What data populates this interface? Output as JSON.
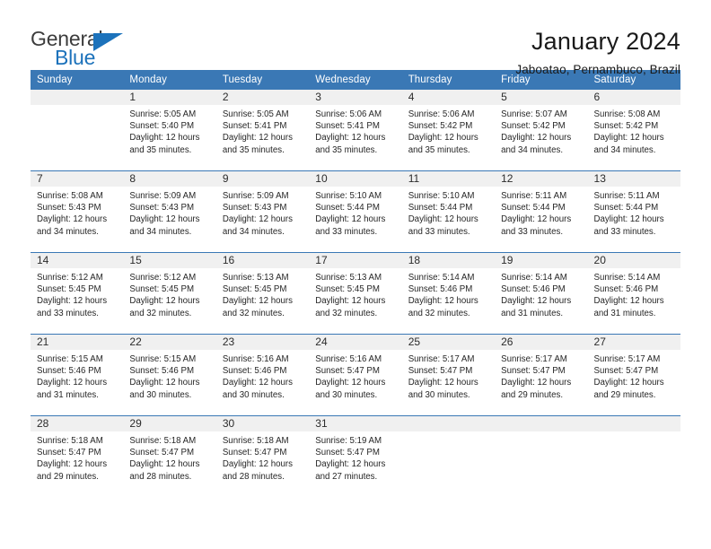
{
  "brand": {
    "name_part1": "General",
    "name_part2": "Blue",
    "accent_color": "#1c72bb",
    "triangle_icon": "brand-triangle-icon"
  },
  "header": {
    "title": "January 2024",
    "subtitle": "Jaboatao, Pernambuco, Brazil"
  },
  "calendar": {
    "header_bg": "#3a78b5",
    "daynum_bg": "#f0f0f0",
    "weekday_headers": [
      "Sunday",
      "Monday",
      "Tuesday",
      "Wednesday",
      "Thursday",
      "Friday",
      "Saturday"
    ],
    "weeks": [
      [
        {
          "day": "",
          "empty": true
        },
        {
          "day": "1",
          "sunrise": "Sunrise: 5:05 AM",
          "sunset": "Sunset: 5:40 PM",
          "daylight": "Daylight: 12 hours and 35 minutes."
        },
        {
          "day": "2",
          "sunrise": "Sunrise: 5:05 AM",
          "sunset": "Sunset: 5:41 PM",
          "daylight": "Daylight: 12 hours and 35 minutes."
        },
        {
          "day": "3",
          "sunrise": "Sunrise: 5:06 AM",
          "sunset": "Sunset: 5:41 PM",
          "daylight": "Daylight: 12 hours and 35 minutes."
        },
        {
          "day": "4",
          "sunrise": "Sunrise: 5:06 AM",
          "sunset": "Sunset: 5:42 PM",
          "daylight": "Daylight: 12 hours and 35 minutes."
        },
        {
          "day": "5",
          "sunrise": "Sunrise: 5:07 AM",
          "sunset": "Sunset: 5:42 PM",
          "daylight": "Daylight: 12 hours and 34 minutes."
        },
        {
          "day": "6",
          "sunrise": "Sunrise: 5:08 AM",
          "sunset": "Sunset: 5:42 PM",
          "daylight": "Daylight: 12 hours and 34 minutes."
        }
      ],
      [
        {
          "day": "7",
          "sunrise": "Sunrise: 5:08 AM",
          "sunset": "Sunset: 5:43 PM",
          "daylight": "Daylight: 12 hours and 34 minutes."
        },
        {
          "day": "8",
          "sunrise": "Sunrise: 5:09 AM",
          "sunset": "Sunset: 5:43 PM",
          "daylight": "Daylight: 12 hours and 34 minutes."
        },
        {
          "day": "9",
          "sunrise": "Sunrise: 5:09 AM",
          "sunset": "Sunset: 5:43 PM",
          "daylight": "Daylight: 12 hours and 34 minutes."
        },
        {
          "day": "10",
          "sunrise": "Sunrise: 5:10 AM",
          "sunset": "Sunset: 5:44 PM",
          "daylight": "Daylight: 12 hours and 33 minutes."
        },
        {
          "day": "11",
          "sunrise": "Sunrise: 5:10 AM",
          "sunset": "Sunset: 5:44 PM",
          "daylight": "Daylight: 12 hours and 33 minutes."
        },
        {
          "day": "12",
          "sunrise": "Sunrise: 5:11 AM",
          "sunset": "Sunset: 5:44 PM",
          "daylight": "Daylight: 12 hours and 33 minutes."
        },
        {
          "day": "13",
          "sunrise": "Sunrise: 5:11 AM",
          "sunset": "Sunset: 5:44 PM",
          "daylight": "Daylight: 12 hours and 33 minutes."
        }
      ],
      [
        {
          "day": "14",
          "sunrise": "Sunrise: 5:12 AM",
          "sunset": "Sunset: 5:45 PM",
          "daylight": "Daylight: 12 hours and 33 minutes."
        },
        {
          "day": "15",
          "sunrise": "Sunrise: 5:12 AM",
          "sunset": "Sunset: 5:45 PM",
          "daylight": "Daylight: 12 hours and 32 minutes."
        },
        {
          "day": "16",
          "sunrise": "Sunrise: 5:13 AM",
          "sunset": "Sunset: 5:45 PM",
          "daylight": "Daylight: 12 hours and 32 minutes."
        },
        {
          "day": "17",
          "sunrise": "Sunrise: 5:13 AM",
          "sunset": "Sunset: 5:45 PM",
          "daylight": "Daylight: 12 hours and 32 minutes."
        },
        {
          "day": "18",
          "sunrise": "Sunrise: 5:14 AM",
          "sunset": "Sunset: 5:46 PM",
          "daylight": "Daylight: 12 hours and 32 minutes."
        },
        {
          "day": "19",
          "sunrise": "Sunrise: 5:14 AM",
          "sunset": "Sunset: 5:46 PM",
          "daylight": "Daylight: 12 hours and 31 minutes."
        },
        {
          "day": "20",
          "sunrise": "Sunrise: 5:14 AM",
          "sunset": "Sunset: 5:46 PM",
          "daylight": "Daylight: 12 hours and 31 minutes."
        }
      ],
      [
        {
          "day": "21",
          "sunrise": "Sunrise: 5:15 AM",
          "sunset": "Sunset: 5:46 PM",
          "daylight": "Daylight: 12 hours and 31 minutes."
        },
        {
          "day": "22",
          "sunrise": "Sunrise: 5:15 AM",
          "sunset": "Sunset: 5:46 PM",
          "daylight": "Daylight: 12 hours and 30 minutes."
        },
        {
          "day": "23",
          "sunrise": "Sunrise: 5:16 AM",
          "sunset": "Sunset: 5:46 PM",
          "daylight": "Daylight: 12 hours and 30 minutes."
        },
        {
          "day": "24",
          "sunrise": "Sunrise: 5:16 AM",
          "sunset": "Sunset: 5:47 PM",
          "daylight": "Daylight: 12 hours and 30 minutes."
        },
        {
          "day": "25",
          "sunrise": "Sunrise: 5:17 AM",
          "sunset": "Sunset: 5:47 PM",
          "daylight": "Daylight: 12 hours and 30 minutes."
        },
        {
          "day": "26",
          "sunrise": "Sunrise: 5:17 AM",
          "sunset": "Sunset: 5:47 PM",
          "daylight": "Daylight: 12 hours and 29 minutes."
        },
        {
          "day": "27",
          "sunrise": "Sunrise: 5:17 AM",
          "sunset": "Sunset: 5:47 PM",
          "daylight": "Daylight: 12 hours and 29 minutes."
        }
      ],
      [
        {
          "day": "28",
          "sunrise": "Sunrise: 5:18 AM",
          "sunset": "Sunset: 5:47 PM",
          "daylight": "Daylight: 12 hours and 29 minutes."
        },
        {
          "day": "29",
          "sunrise": "Sunrise: 5:18 AM",
          "sunset": "Sunset: 5:47 PM",
          "daylight": "Daylight: 12 hours and 28 minutes."
        },
        {
          "day": "30",
          "sunrise": "Sunrise: 5:18 AM",
          "sunset": "Sunset: 5:47 PM",
          "daylight": "Daylight: 12 hours and 28 minutes."
        },
        {
          "day": "31",
          "sunrise": "Sunrise: 5:19 AM",
          "sunset": "Sunset: 5:47 PM",
          "daylight": "Daylight: 12 hours and 27 minutes."
        },
        {
          "day": "",
          "empty": true
        },
        {
          "day": "",
          "empty": true
        },
        {
          "day": "",
          "empty": true
        }
      ]
    ]
  }
}
